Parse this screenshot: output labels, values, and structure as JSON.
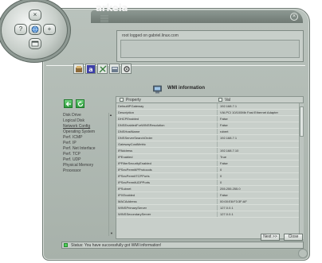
{
  "app": {
    "logo": "arkeia"
  },
  "title_bar": {
    "close_glyph": "×"
  },
  "orb_controls": [
    {
      "icon": "close-icon",
      "glyph": "×"
    },
    {
      "icon": "help-icon",
      "glyph": "?"
    },
    {
      "icon": "globe-icon",
      "glyph": ""
    },
    {
      "icon": "add-icon",
      "glyph": "+"
    },
    {
      "icon": "window-icon",
      "glyph": ""
    }
  ],
  "login": {
    "status_text": "root logged on gabriel.linux.com"
  },
  "toolbar": {
    "buttons": [
      "backup-icon",
      "text-icon",
      "tools-icon",
      "archive-icon",
      "settings-icon"
    ]
  },
  "module": {
    "title": "WMI information",
    "icon": "wmi-icon"
  },
  "navigation": {
    "back_icon": "back-arrow-icon",
    "refresh_icon": "refresh-icon"
  },
  "categories": {
    "items": [
      "Disk Drive",
      "Logical Disk",
      "Network Config",
      "Operating System",
      "Perf. ICMP",
      "Perf. IP",
      "Perf. Net Interface",
      "Perf. TCP",
      "Perf. UDP",
      "Physical Memory",
      "Processor"
    ],
    "selected": "Network Config",
    "scroll_up": "▲",
    "scroll_down": "▼"
  },
  "grid": {
    "columns": {
      "property": "Property",
      "value": "Val"
    },
    "rows": [
      {
        "property": "DefaultIPGateway",
        "value": "192.168.7.1"
      },
      {
        "property": "Description",
        "value": "VIA PCI 10/100Mb Fast Ethernet Adapter"
      },
      {
        "property": "DHCPEnabled",
        "value": "False"
      },
      {
        "property": "DNSEnabledForWINSResolution",
        "value": "False"
      },
      {
        "property": "DNSHostName",
        "value": "robert"
      },
      {
        "property": "DNSServerSearchOrder",
        "value": "192.168.7.1"
      },
      {
        "property": "GatewayCostMetric",
        "value": ""
      },
      {
        "property": "IPAddress",
        "value": "192.168.7.10"
      },
      {
        "property": "IPEnabled",
        "value": "True"
      },
      {
        "property": "IPFilterSecurityEnabled",
        "value": "False"
      },
      {
        "property": "IPSecPermitIPProtocols",
        "value": "0"
      },
      {
        "property": "IPSecPermitTCPPorts",
        "value": "0"
      },
      {
        "property": "IPSecPermitUDPPorts",
        "value": "0"
      },
      {
        "property": "IPSubnet",
        "value": "255.255.255.0"
      },
      {
        "property": "IPXEnabled",
        "value": "False"
      },
      {
        "property": "MACAddress",
        "value": "00:00:E8:F3:3F:AF"
      },
      {
        "property": "WINSPrimaryServer",
        "value": "127.0.0.1"
      },
      {
        "property": "WINSSecondaryServer",
        "value": "127.0.0.1"
      }
    ]
  },
  "buttons": {
    "next": "Next >>",
    "close": "Close"
  },
  "status": {
    "message": "Status: You have successfully got WMI information!"
  },
  "colors": {
    "window": "#b3bcb6",
    "panel": "#c8cfca",
    "accent_green": "#2c9a3b",
    "status_led": "#4ecf58"
  }
}
